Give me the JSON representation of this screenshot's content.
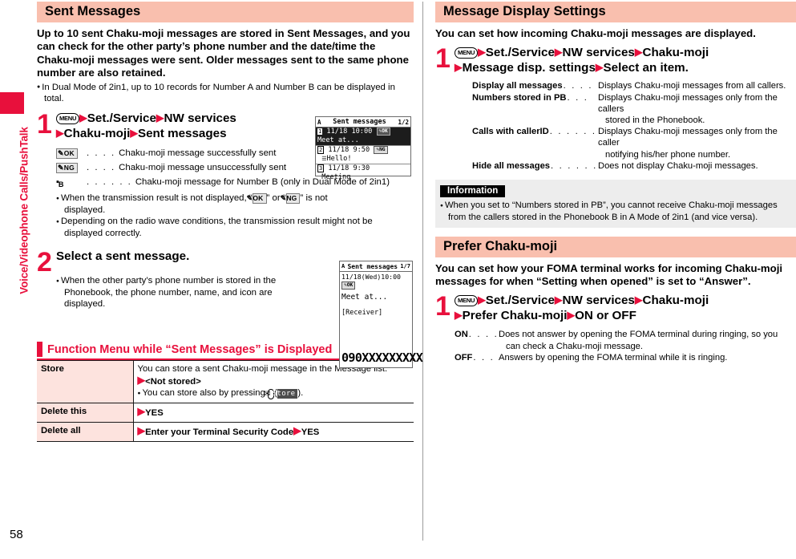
{
  "sidebar": {
    "chapter_label": "Voice/Videophone Calls/PushTalk",
    "accent_color": "#e8103c"
  },
  "page_number": "58",
  "left_column": {
    "section": {
      "title": "Sent Messages",
      "intro": "Up to 10 sent Chaku-moji messages are stored in Sent Messages, and you can check for the other party’s phone number and the date/time the Chaku-moji messages were sent. Older messages sent to the same phone number are also retained.",
      "intro_bullet": "In Dual Mode of 2in1, up to 10 records for Number A and Number B can be displayed in total."
    },
    "step1": {
      "number": "1",
      "key_icon": "MENU",
      "line1_parts": [
        "Set./Service",
        "NW services"
      ],
      "line2_parts": [
        "Chaku-moji",
        "Sent messages"
      ],
      "legend": [
        {
          "icon": "ok-badge",
          "icon_text": "OK",
          "dots": ". . . .",
          "text": "Chaku-moji message successfully sent"
        },
        {
          "icon": "ng-badge",
          "icon_text": "NG",
          "dots": ". . . .",
          "text": "Chaku-moji message unsuccessfully sent"
        },
        {
          "icon": "number-b-icon",
          "icon_text": "⬛ᴮ",
          "dots": ". . . . . .",
          "text": "Chaku-moji message for Number B (only in Dual Mode of 2in1)"
        }
      ],
      "bullets": [
        {
          "pre": "When the transmission result is not displayed, “",
          "badge1": "OK",
          "mid": "” or “",
          "badge2": "NG",
          "post": "” is not",
          "cont": "displayed."
        },
        {
          "pre": "Depending on the radio wave conditions, the transmission result might not be",
          "cont": "displayed correctly."
        }
      ],
      "phone_screen": {
        "name": "sent-messages-list",
        "status_left": "A",
        "title": "Sent messages",
        "counter": "1/2",
        "rows": [
          {
            "index": "1",
            "date": "11/18 10:00",
            "badge": "OK",
            "body": "Meet at...",
            "selected": true
          },
          {
            "index": "2",
            "date": "11/18  9:50",
            "badge": "NG",
            "body": "Hello!",
            "selected": false
          },
          {
            "index": "3",
            "date": "11/18  9:30",
            "badge": "",
            "body": "Meeting",
            "selected": false
          }
        ]
      }
    },
    "step2": {
      "number": "2",
      "title": "Select a sent message.",
      "bullets": [
        {
          "pre": "When the other party’s phone number is stored in the",
          "cont": "Phonebook, the phone number, name, and icon are displayed."
        }
      ],
      "phone_screen": {
        "name": "sent-message-detail",
        "status_left": "A",
        "title": "Sent messages",
        "counter": "1/7",
        "datetime": "11/18(Wed)10:00",
        "badge": "OK",
        "body": "Meet at...",
        "receiver_label": "[Receiver]",
        "phone_number": "090XXXXXXXXX"
      }
    },
    "function_menu": {
      "heading": "Function Menu while “Sent Messages” is Displayed",
      "rows": [
        {
          "key": "Store",
          "desc_line1": "You can store a sent Chaku-moji message in the Message list.",
          "desc_line2": "<Not stored>",
          "desc_bullet_pre": "You can store also by pressing ",
          "desc_bullet_softkey": "Store",
          "desc_bullet_post": ")."
        },
        {
          "key": "Delete this",
          "value": "YES"
        },
        {
          "key": "Delete all",
          "value_a": "Enter your Terminal Security Code",
          "value_b": "YES"
        }
      ]
    }
  },
  "right_column": {
    "section1": {
      "title": "Message Display Settings",
      "intro": "You can set how incoming Chaku-moji messages are displayed.",
      "step": {
        "number": "1",
        "key_icon": "MENU",
        "line1_parts": [
          "Set./Service",
          "NW services",
          "Chaku-moji"
        ],
        "line2_parts": [
          "Message disp. settings",
          "Select an item."
        ]
      },
      "options": [
        {
          "term": "Display all messages",
          "desc": "Displays Chaku-moji messages from all callers.",
          "desc2": ""
        },
        {
          "term": "Numbers stored in PB",
          "desc": "Displays Chaku-moji messages only from the callers",
          "desc2": "stored in the Phonebook."
        },
        {
          "term": "Calls with callerID",
          "desc": "Displays Chaku-moji messages only from the caller",
          "desc2": "notifying his/her phone number."
        },
        {
          "term": "Hide all messages",
          "desc": "Does not display Chaku-moji messages.",
          "desc2": ""
        }
      ],
      "information": {
        "title": "Information",
        "bullet_line1": "When you set to “Numbers stored in PB”, you cannot receive Chaku-moji messages",
        "bullet_line2": "from the callers stored in the Phonebook B in A Mode of 2in1 (and vice versa)."
      }
    },
    "section2": {
      "title": "Prefer Chaku-moji",
      "intro": "You can set how your FOMA terminal works for incoming Chaku-moji messages for when “Setting when opened” is set to “Answer”.",
      "step": {
        "number": "1",
        "key_icon": "MENU",
        "line1_parts": [
          "Set./Service",
          "NW services",
          "Chaku-moji"
        ],
        "line2_parts": [
          "Prefer Chaku-moji",
          "ON or OFF"
        ]
      },
      "options": [
        {
          "term": "ON",
          "desc": "Does not answer by opening the FOMA terminal during ringing, so you",
          "desc2": "can check a Chaku-moji message."
        },
        {
          "term": "OFF",
          "desc": "Answers by opening the FOMA terminal while it is ringing.",
          "desc2": ""
        }
      ]
    }
  }
}
